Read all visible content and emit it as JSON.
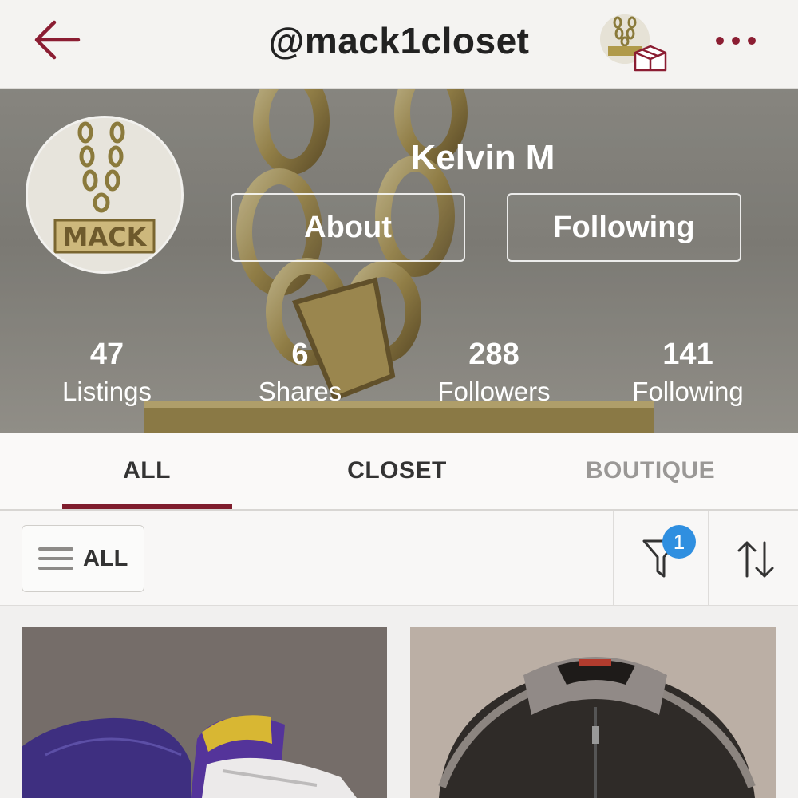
{
  "header": {
    "title": "@mack1closet",
    "back_icon": "back-arrow-icon",
    "menu_icon": "more-dots-icon",
    "accent_color": "#8b1d32"
  },
  "profile": {
    "name": "Kelvin M",
    "about_label": "About",
    "following_button_label": "Following",
    "avatar_text": "MACK",
    "stats": [
      {
        "value": "47",
        "label": "Listings"
      },
      {
        "value": "6",
        "label": "Shares"
      },
      {
        "value": "288",
        "label": "Followers"
      },
      {
        "value": "141",
        "label": "Following"
      }
    ]
  },
  "tabs": [
    {
      "label": "ALL",
      "active": true
    },
    {
      "label": "CLOSET",
      "active": false
    },
    {
      "label": "BOUTIQUE",
      "active": false
    }
  ],
  "filter_bar": {
    "category_label": "ALL",
    "filter_badge": "1",
    "badge_color": "#2f8fe0"
  }
}
